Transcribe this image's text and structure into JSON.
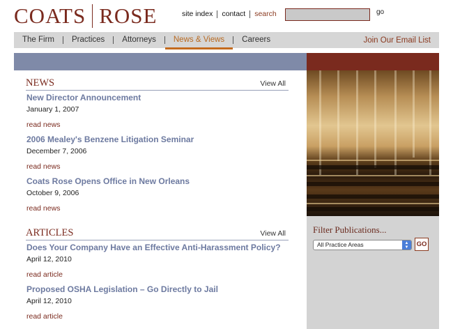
{
  "brand": {
    "left": "COATS",
    "right": "ROSE"
  },
  "utility": {
    "site_index": "site index",
    "contact": "contact",
    "search": "search",
    "go": "go"
  },
  "nav": {
    "items": [
      "The Firm",
      "Practices",
      "Attorneys",
      "News & Views",
      "Careers"
    ],
    "active": "News & Views",
    "join": "Join Our Email List"
  },
  "news": {
    "title": "NEWS",
    "view_all": "View All",
    "entries": [
      {
        "headline": "New Director Announcement",
        "date": "January 1, 2007",
        "link": "read news"
      },
      {
        "headline": "2006 Mealey's Benzene Litigation Seminar",
        "date": "December 7, 2006",
        "link": "read news"
      },
      {
        "headline": "Coats Rose Opens Office in New Orleans",
        "date": "October 9, 2006",
        "link": "read news"
      }
    ]
  },
  "articles": {
    "title": "ARTICLES",
    "view_all": "View All",
    "entries": [
      {
        "headline": "Does Your Company Have an Effective Anti-Harassment Policy?",
        "date": "April 12, 2010",
        "link": "read article"
      },
      {
        "headline": "Proposed OSHA Legislation – Go Directly to Jail",
        "date": "April 12, 2010",
        "link": "read article"
      }
    ]
  },
  "filter": {
    "title": "Filter Publications...",
    "selected": "All Practice Areas",
    "go": "GO"
  },
  "colors": {
    "brand": "#7a2a1e",
    "nav_active": "#c46b1e",
    "blue_band": "#7f8aa8",
    "headline": "#6d7aa0"
  }
}
